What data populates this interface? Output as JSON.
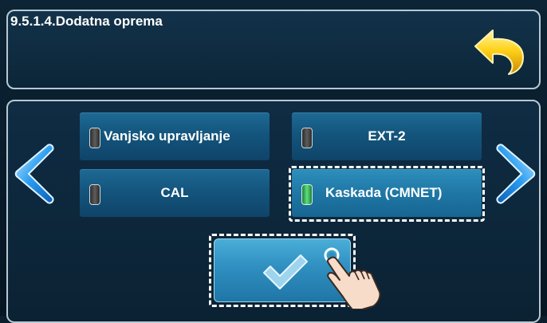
{
  "header": {
    "title": "9.5.1.4.Dodatna oprema",
    "back_icon": "back-arrow-icon"
  },
  "options": [
    {
      "label": "Vanjsko upravljanje",
      "active": false
    },
    {
      "label": "EXT-2",
      "active": false
    },
    {
      "label": "CAL",
      "active": false
    },
    {
      "label": "Kaskada (CMNET)",
      "active": true
    }
  ],
  "navigation": {
    "prev_icon": "chevron-left-icon",
    "next_icon": "chevron-right-icon"
  },
  "confirm": {
    "icon": "checkmark-icon",
    "hint_icon": "tap-hand-icon"
  },
  "colors": {
    "background": "#0a1e2e",
    "button": "#14557d",
    "button_selected": "#1f77a5",
    "led_off": "#5d5d5d",
    "led_on": "#5ee07c",
    "arrow": "#1a8fe0"
  }
}
